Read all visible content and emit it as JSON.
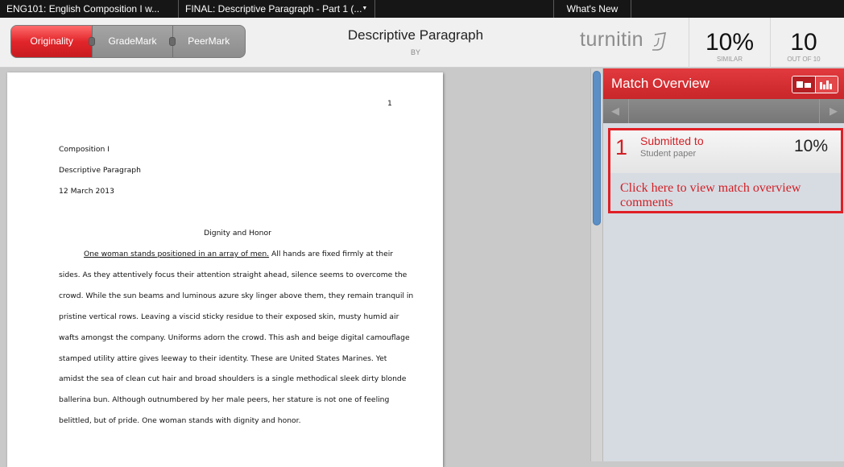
{
  "topbar": {
    "course_tab": "ENG101: English Composition I w...",
    "assignment_tab": "FINAL: Descriptive Paragraph - Part 1 (...",
    "whats_new": "What's New"
  },
  "modes": {
    "originality": "Originality",
    "grademark": "GradeMark",
    "peermark": "PeerMark",
    "active": "Originality"
  },
  "header": {
    "title": "Descriptive Paragraph",
    "by": "BY",
    "logo": "turnitin",
    "similarity_value": "10%",
    "similarity_label": "SIMILAR",
    "score_value": "10",
    "score_label": "OUT OF 10"
  },
  "document": {
    "page_number": "1",
    "heading": [
      "Composition I",
      "Descriptive Paragraph",
      "12 March 2013"
    ],
    "title": "Dignity and Honor",
    "first_sentence": "One woman stands positioned in an array of men.",
    "first_line_rest": " All hands are fixed firmly at their",
    "lines": [
      "sides. As they attentively focus their attention straight ahead, silence seems to overcome the",
      "crowd. While the sun beams and luminous azure sky linger above them, they remain tranquil in",
      "pristine vertical rows. Leaving a viscid sticky residue to their exposed skin, musty humid air",
      "wafts amongst the company. Uniforms adorn the crowd. This ash and beige digital camouflage",
      "stamped utility attire gives leeway to their identity. These are United States Marines. Yet",
      "amidst the sea of clean cut hair and broad shoulders is a single methodical sleek dirty blonde",
      "ballerina bun. Although outnumbered by her male peers, her stature is not one of feeling",
      "belittled, but of pride. One woman stands with dignity and honor."
    ]
  },
  "panel": {
    "title": "Match Overview",
    "accent": "#d42a2e",
    "match": {
      "number": "1",
      "source": "Submitted to",
      "type": "Student paper",
      "percent": "10%"
    },
    "note": "Click here to view match overview comments"
  }
}
